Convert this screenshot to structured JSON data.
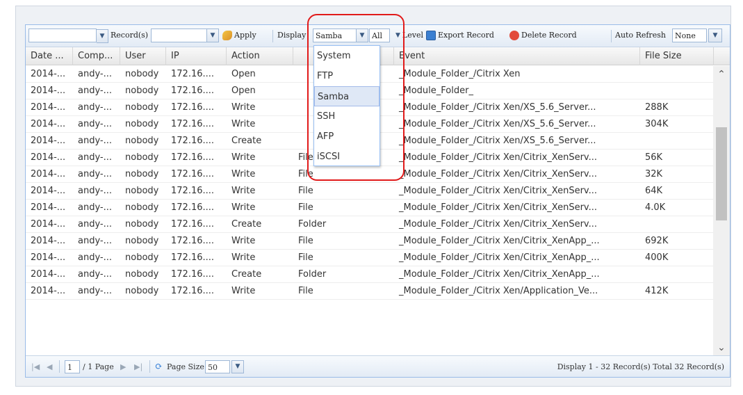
{
  "toolbar": {
    "records_select_value": "",
    "records_label": "Record(s)",
    "second_select_value": "",
    "apply_label": "Apply",
    "display_label": "Display",
    "display_value": "Samba",
    "all_value": "All",
    "level_label": "Level",
    "export_label": "Export Record",
    "delete_label": "Delete Record",
    "auto_refresh_label": "Auto Refresh",
    "auto_refresh_value": "None"
  },
  "columns": [
    "Date ...",
    "Comp...",
    "User",
    "IP",
    "Action",
    "",
    "Event",
    "File Size"
  ],
  "rows": [
    [
      "2014-...",
      "andy-...",
      "nobody",
      "172.16....",
      "Open",
      "",
      "_Module_Folder_/Citrix Xen",
      ""
    ],
    [
      "2014-...",
      "andy-...",
      "nobody",
      "172.16....",
      "Open",
      "",
      "_Module_Folder_",
      ""
    ],
    [
      "2014-...",
      "andy-...",
      "nobody",
      "172.16....",
      "Write",
      "",
      "_Module_Folder_/Citrix Xen/XS_5.6_Server...",
      "288K"
    ],
    [
      "2014-...",
      "andy-...",
      "nobody",
      "172.16....",
      "Write",
      "",
      "_Module_Folder_/Citrix Xen/XS_5.6_Server...",
      "304K"
    ],
    [
      "2014-...",
      "andy-...",
      "nobody",
      "172.16....",
      "Create",
      "",
      "_Module_Folder_/Citrix Xen/XS_5.6_Server...",
      ""
    ],
    [
      "2014-...",
      "andy-...",
      "nobody",
      "172.16....",
      "Write",
      "File",
      "_Module_Folder_/Citrix Xen/Citrix_XenServ...",
      "56K"
    ],
    [
      "2014-...",
      "andy-...",
      "nobody",
      "172.16....",
      "Write",
      "File",
      "_Module_Folder_/Citrix Xen/Citrix_XenServ...",
      "32K"
    ],
    [
      "2014-...",
      "andy-...",
      "nobody",
      "172.16....",
      "Write",
      "File",
      "_Module_Folder_/Citrix Xen/Citrix_XenServ...",
      "64K"
    ],
    [
      "2014-...",
      "andy-...",
      "nobody",
      "172.16....",
      "Write",
      "File",
      "_Module_Folder_/Citrix Xen/Citrix_XenServ...",
      "4.0K"
    ],
    [
      "2014-...",
      "andy-...",
      "nobody",
      "172.16....",
      "Create",
      "Folder",
      "_Module_Folder_/Citrix Xen/Citrix_XenServ...",
      ""
    ],
    [
      "2014-...",
      "andy-...",
      "nobody",
      "172.16....",
      "Write",
      "File",
      "_Module_Folder_/Citrix Xen/Citrix_XenApp_...",
      "692K"
    ],
    [
      "2014-...",
      "andy-...",
      "nobody",
      "172.16....",
      "Write",
      "File",
      "_Module_Folder_/Citrix Xen/Citrix_XenApp_...",
      "400K"
    ],
    [
      "2014-...",
      "andy-...",
      "nobody",
      "172.16....",
      "Create",
      "Folder",
      "_Module_Folder_/Citrix Xen/Citrix_XenApp_...",
      ""
    ],
    [
      "2014-...",
      "andy-...",
      "nobody",
      "172.16....",
      "Write",
      "File",
      "_Module_Folder_/Citrix Xen/Application_Ve...",
      "412K"
    ]
  ],
  "display_dropdown": {
    "options": [
      "System",
      "FTP",
      "Samba",
      "SSH",
      "AFP",
      "iSCSI"
    ],
    "selected": "Samba"
  },
  "pager": {
    "page_value": "1",
    "page_total": "/ 1 Page",
    "page_size_label": "Page Size",
    "page_size_value": "50",
    "status": "Display 1 - 32 Record(s) Total 32 Record(s)"
  },
  "colors": {
    "highlight": "#e11a1a",
    "grid_border": "#99bbe8",
    "selected_option": "#dfe8f6"
  },
  "icons": {
    "apply": "apply-icon",
    "export": "export-icon",
    "delete": "delete-icon",
    "refresh": "refresh-icon"
  }
}
